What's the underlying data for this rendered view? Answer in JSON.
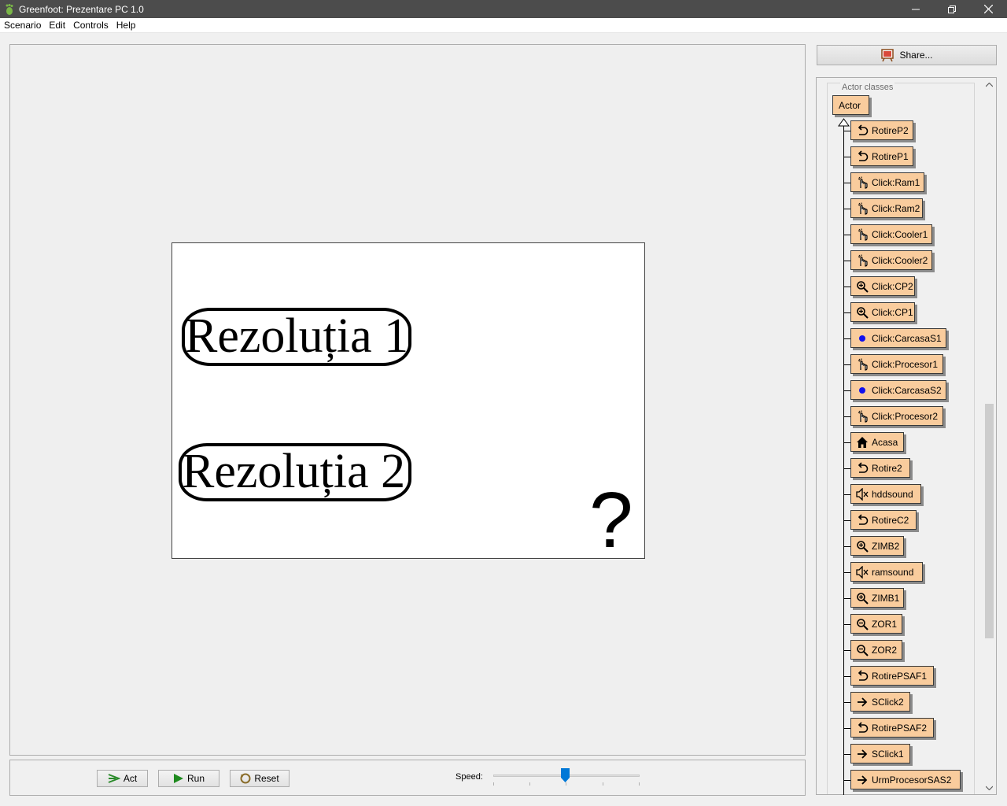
{
  "window": {
    "title": "Greenfoot: Prezentare PC 1.0"
  },
  "menu": [
    "Scenario",
    "Edit",
    "Controls",
    "Help"
  ],
  "world": {
    "button1": "Rezoluția 1",
    "button2": "Rezoluția 2",
    "help_symbol": "?"
  },
  "controls": {
    "act_label": "Act",
    "run_label": "Run",
    "reset_label": "Reset",
    "speed_label": "Speed:",
    "speed_value": 0.5
  },
  "share_label": "Share...",
  "class_panel": {
    "group_label": "Actor classes",
    "root": "Actor",
    "classes": [
      {
        "name": "RotireP2",
        "icon": "rotate-icon"
      },
      {
        "name": "RotireP1",
        "icon": "rotate-icon"
      },
      {
        "name": "Click:Ram1",
        "icon": "hand-pointer-icon"
      },
      {
        "name": "Click:Ram2",
        "icon": "hand-pointer-icon"
      },
      {
        "name": "Click:Cooler1",
        "icon": "hand-pointer-icon"
      },
      {
        "name": "Click:Cooler2",
        "icon": "hand-pointer-icon"
      },
      {
        "name": "Click:CP2",
        "icon": "zoom-in-icon"
      },
      {
        "name": "Click:CP1",
        "icon": "zoom-in-icon"
      },
      {
        "name": "Click:CarcasaS1",
        "icon": "blue-dot-icon"
      },
      {
        "name": "Click:Procesor1",
        "icon": "hand-pointer-icon"
      },
      {
        "name": "Click:CarcasaS2",
        "icon": "blue-dot-icon"
      },
      {
        "name": "Click:Procesor2",
        "icon": "hand-pointer-icon"
      },
      {
        "name": "Acasa",
        "icon": "home-icon"
      },
      {
        "name": "Rotire2",
        "icon": "rotate-icon"
      },
      {
        "name": "hddsound",
        "icon": "speaker-icon"
      },
      {
        "name": "RotireC2",
        "icon": "rotate-icon"
      },
      {
        "name": "ZIMB2",
        "icon": "zoom-in-icon"
      },
      {
        "name": "ramsound",
        "icon": "speaker-icon"
      },
      {
        "name": "ZIMB1",
        "icon": "zoom-in-icon"
      },
      {
        "name": "ZOR1",
        "icon": "zoom-out-icon"
      },
      {
        "name": "ZOR2",
        "icon": "zoom-out-icon"
      },
      {
        "name": "RotirePSAF1",
        "icon": "rotate-icon"
      },
      {
        "name": "SClick2",
        "icon": "arrow-right-icon"
      },
      {
        "name": "RotirePSAF2",
        "icon": "rotate-icon"
      },
      {
        "name": "SClick1",
        "icon": "arrow-right-icon"
      },
      {
        "name": "UrmProcesorSAS2",
        "icon": "arrow-right-icon"
      }
    ]
  }
}
